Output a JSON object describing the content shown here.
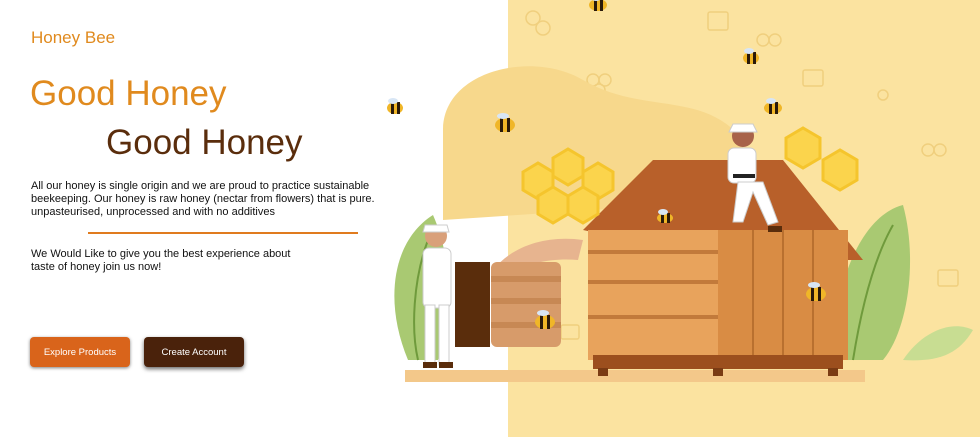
{
  "brand": {
    "name": "Honey Bee"
  },
  "hero": {
    "headline_primary": "Good Honey",
    "headline_secondary": "Good Honey",
    "description": "All our honey is single origin and we are proud to practice sustainable beekeeping. Our honey is raw honey (nectar from flowers) that is pure. unpasteurised, unprocessed and with no additives",
    "invite": "We Would Like to give you the best experience about taste of honey join us now!"
  },
  "buttons": {
    "explore_label": "Explore Products",
    "create_label": "Create Account"
  },
  "colors": {
    "accent_orange": "#e08a1e",
    "dark_brown": "#5a2d0c",
    "button_orange": "#d9641b",
    "button_brown": "#4a220b",
    "hero_background": "#fbe3a0"
  },
  "illustration": {
    "subject": "beekeepers-with-beehive-illustration"
  }
}
